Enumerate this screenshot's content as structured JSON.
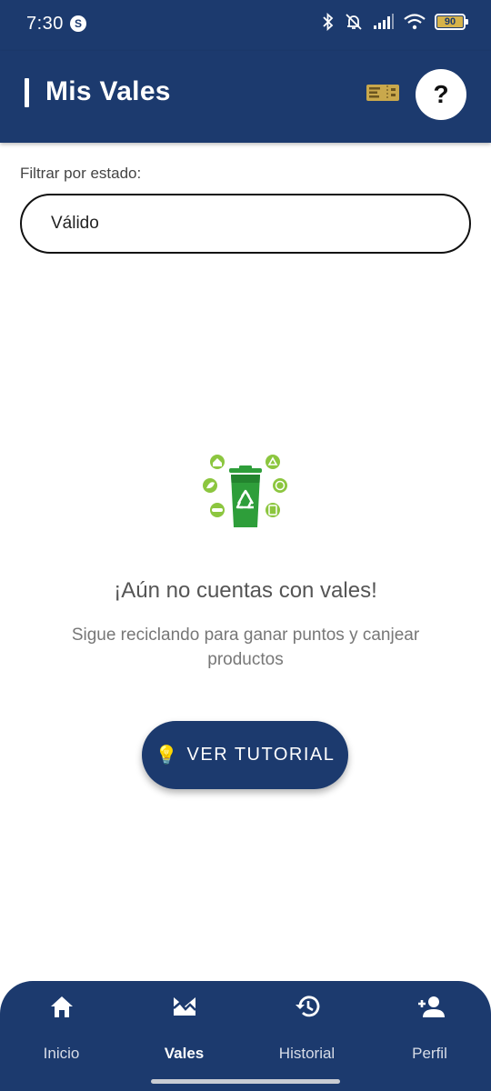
{
  "status_bar": {
    "time": "7:30",
    "app_icon": "S",
    "battery_level": "90"
  },
  "header": {
    "title": "Mis Vales",
    "ticket_icon": "ticket-icon",
    "help_label": "?"
  },
  "filter": {
    "label": "Filtrar por estado:",
    "selected": "Válido"
  },
  "empty_state": {
    "illustration": "recycle-bin-icon",
    "title": "¡Aún no cuentas con vales!",
    "subtitle": "Sigue reciclando para ganar puntos y canjear productos"
  },
  "tutorial_button": {
    "icon": "💡",
    "label": "VER TUTORIAL"
  },
  "bottom_nav": {
    "items": [
      {
        "label": "Inicio",
        "icon": "home-icon",
        "active": false
      },
      {
        "label": "Vales",
        "icon": "vouchers-icon",
        "active": true
      },
      {
        "label": "Historial",
        "icon": "history-icon",
        "active": false
      },
      {
        "label": "Perfil",
        "icon": "add-person-icon",
        "active": false
      }
    ]
  },
  "colors": {
    "primary": "#1c3a6e",
    "recycle_green": "#2e9e3a",
    "leaf_green": "#8cc63f"
  }
}
